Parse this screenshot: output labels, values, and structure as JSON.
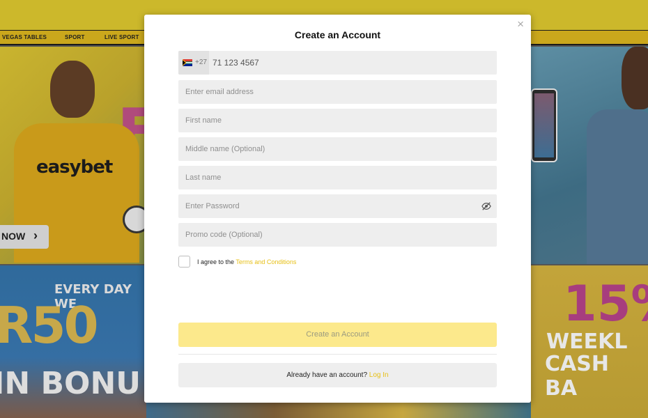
{
  "nav": {
    "vegas_tables": "VEGAS TABLES",
    "sport": "SPORT",
    "live_sport": "LIVE SPORT"
  },
  "background": {
    "shirt_brand": "easybet",
    "hero_letter": "F",
    "cta_label": "NOW",
    "everyday_text": "EVERY DAY WE",
    "r50_text": "R50",
    "bonus_text": "IN BONU",
    "percent_text": "15%",
    "weekly_text": "WEEKL",
    "cashback_text": "CASH BA"
  },
  "modal": {
    "title": "Create an Account",
    "close_icon": "×",
    "phone": {
      "country_code": "+27",
      "flag_icon": "south-africa-flag",
      "value": "71 123 4567"
    },
    "fields": {
      "email_placeholder": "Enter email address",
      "first_name_placeholder": "First name",
      "middle_name_placeholder": "Middle name (Optional)",
      "last_name_placeholder": "Last name",
      "password_placeholder": "Enter Password",
      "password_icon": "eye-slash-icon",
      "promo_placeholder": "Promo code (Optional)"
    },
    "agree": {
      "text": "I agree to the",
      "link": "Terms and Conditions"
    },
    "submit_label": "Create an Account",
    "login": {
      "text": "Already have an account?",
      "link": "Log In"
    }
  },
  "colors": {
    "accent_yellow": "#fce98c",
    "link_yellow": "#e7bf14",
    "field_bg": "#eeeeee"
  }
}
